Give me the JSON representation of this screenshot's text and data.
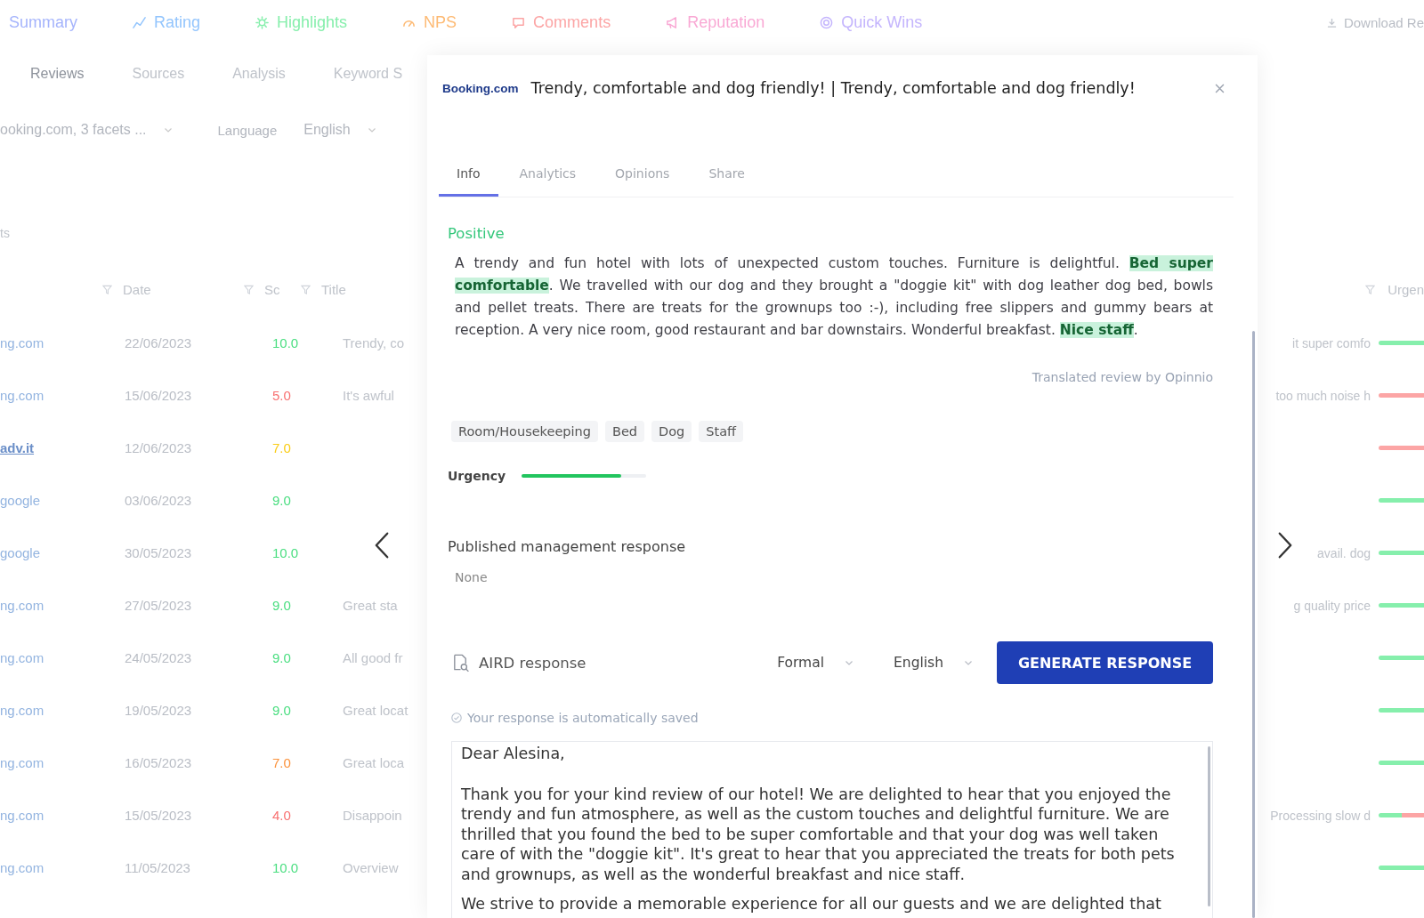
{
  "top_nav": [
    {
      "label": "Summary",
      "color": "#a5b4fc"
    },
    {
      "label": "Rating",
      "color": "#93c5fd"
    },
    {
      "label": "Highlights",
      "color": "#86efac"
    },
    {
      "label": "NPS",
      "color": "#fdba74"
    },
    {
      "label": "Comments",
      "color": "#fca5a5"
    },
    {
      "label": "Reputation",
      "color": "#f9a8d4"
    },
    {
      "label": "Quick Wins",
      "color": "#c4b5fd"
    }
  ],
  "top_right": {
    "label": "Download Re"
  },
  "sub_tabs": [
    {
      "label": "Reviews",
      "selected": true
    },
    {
      "label": "Sources",
      "selected": false
    },
    {
      "label": "Analysis",
      "selected": false
    },
    {
      "label": "Keyword S",
      "selected": false
    }
  ],
  "filters": {
    "sources": "ooking.com, 3 facets ...",
    "language_label": "Language",
    "language": "English"
  },
  "partial_label": "ts",
  "table": {
    "columns": [
      "Date",
      "Sc",
      "Title"
    ],
    "rows": [
      {
        "source": "ng.com",
        "date": "22/06/2023",
        "score": "10.0",
        "color": "#4ade80",
        "title": "Trendy, co"
      },
      {
        "source": "ng.com",
        "date": "15/06/2023",
        "score": "5.0",
        "color": "#f87171",
        "title": "It's awful"
      },
      {
        "source": "adv.it",
        "date": "12/06/2023",
        "score": "7.0",
        "color": "#facc15"
      },
      {
        "source": "google",
        "date": "03/06/2023",
        "score": "9.0",
        "color": "#4ade80"
      },
      {
        "source": "google",
        "date": "30/05/2023",
        "score": "10.0",
        "color": "#4ade80"
      },
      {
        "source": "ng.com",
        "date": "27/05/2023",
        "score": "9.0",
        "color": "#4ade80",
        "title": "Great sta"
      },
      {
        "source": "ng.com",
        "date": "24/05/2023",
        "score": "9.0",
        "color": "#4ade80",
        "title": "All good fr"
      },
      {
        "source": "ng.com",
        "date": "19/05/2023",
        "score": "9.0",
        "color": "#4ade80",
        "title": "Great locat"
      },
      {
        "source": "ng.com",
        "date": "16/05/2023",
        "score": "7.0",
        "color": "#fb923c",
        "title": "Great loca"
      },
      {
        "source": "ng.com",
        "date": "15/05/2023",
        "score": "4.0",
        "color": "#f87171",
        "title": "Disappoin"
      },
      {
        "source": "ng.com",
        "date": "11/05/2023",
        "score": "10.0",
        "color": "#4ade80",
        "title": "Overview"
      }
    ]
  },
  "right_column": {
    "header": "Urgen",
    "rows": [
      {
        "text": "it super comfo",
        "segments": [
          {
            "color": "#86efac"
          }
        ]
      },
      {
        "text": "too much noise h",
        "segments": [
          {
            "color": "#fca5a5"
          }
        ]
      },
      {
        "segments": [
          {
            "color": "#fca5a5"
          }
        ]
      },
      {
        "segments": [
          {
            "color": "#86efac"
          }
        ]
      },
      {
        "text": "avail. dog",
        "segments": [
          {
            "color": "#86efac"
          }
        ]
      },
      {
        "text": "g quality price",
        "segments": [
          {
            "color": "#86efac"
          }
        ]
      },
      {
        "segments": [
          {
            "color": "#86efac"
          }
        ]
      },
      {
        "segments": [
          {
            "color": "#86efac"
          }
        ]
      },
      {
        "segments": [
          {
            "color": "#86efac"
          }
        ]
      },
      {
        "text": "Processing slow d",
        "segments": [
          {
            "color": "#86efac"
          },
          {
            "color": "#fca5a5"
          }
        ]
      },
      {
        "segments": [
          {
            "color": "#86efac"
          }
        ]
      }
    ]
  },
  "modal": {
    "source": "Booking.com",
    "title": "Trendy, comfortable and dog friendly! | Trendy, comfortable and dog friendly!",
    "tabs": [
      {
        "label": "Info",
        "selected": true
      },
      {
        "label": "Analytics",
        "selected": false
      },
      {
        "label": "Opinions",
        "selected": false
      },
      {
        "label": "Share",
        "selected": false
      }
    ],
    "sentiment": "Positive",
    "review": "A trendy and fun hotel with lots of unexpected custom touches. Furniture is delightful. **Bed super comfortable**. We travelled with our dog and they brought a \"doggie kit\" with dog leather dog bed, bowls and pellet treats. There are treats for the grownups too :-), including free slippers and gummy bears at reception. A very nice room, good restaurant and bar downstairs. Wonderful breakfast. **Nice staff**.",
    "translation_note": "Translated review by Opinnio",
    "tags": [
      "Room/Housekeeping",
      "Bed",
      "Dog",
      "Staff"
    ],
    "urgency": {
      "label": "Urgency",
      "level": 0.8
    },
    "published": {
      "label": "Published management response",
      "value": "None"
    },
    "ai": {
      "label": "AIRD response",
      "tone": "Formal",
      "language": "English",
      "button": "GENERATE RESPONSE",
      "autosave_note": "Your response is automatically saved",
      "response": [
        "Dear Alesina,",
        "Thank you for your kind review of our hotel! We are delighted to hear that you enjoyed the trendy and fun atmosphere, as well as the custom touches and delightful furniture. We are thrilled that you found the bed to be super comfortable and that your dog was well taken care of with the \"doggie kit\". It's great to hear that you appreciated the treats for both pets and grownups, as well as the wonderful breakfast and nice staff.",
        "We strive to provide a memorable experience for all our guests and we are delighted that"
      ]
    }
  }
}
